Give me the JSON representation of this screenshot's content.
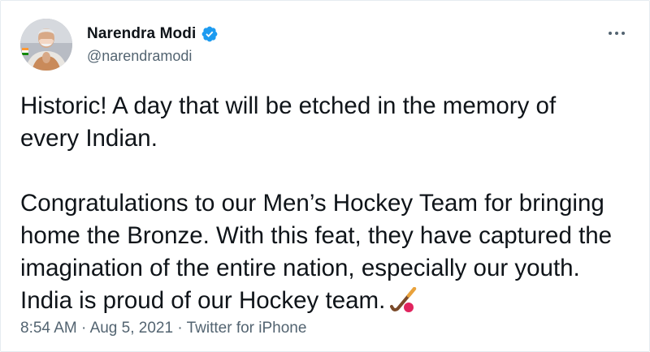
{
  "author": {
    "display_name": "Narendra Modi",
    "handle": "@narendramodi",
    "verified": true
  },
  "icons": {
    "avatar": "profile-photo",
    "verified": "verified-badge-icon",
    "more": "more-options-icon",
    "emoji": "field-hockey-emoji"
  },
  "tweet": {
    "line1": "Historic! A day that will be etched in the memory of",
    "line2": "every Indian.",
    "line3": "Congratulations to our Men’s Hockey Team for bringing",
    "line4": "home the Bronze. With this feat, they have captured the",
    "line5": "imagination of the entire nation, especially our youth.",
    "line6": "India is proud of our Hockey team."
  },
  "meta": {
    "time": "8:54 AM",
    "separator": " · ",
    "date": "Aug 5, 2021",
    "source": "Twitter for iPhone"
  },
  "colors": {
    "verified_blue": "#1d9bf0",
    "secondary_text": "#536471",
    "primary_text": "#0f1419"
  }
}
